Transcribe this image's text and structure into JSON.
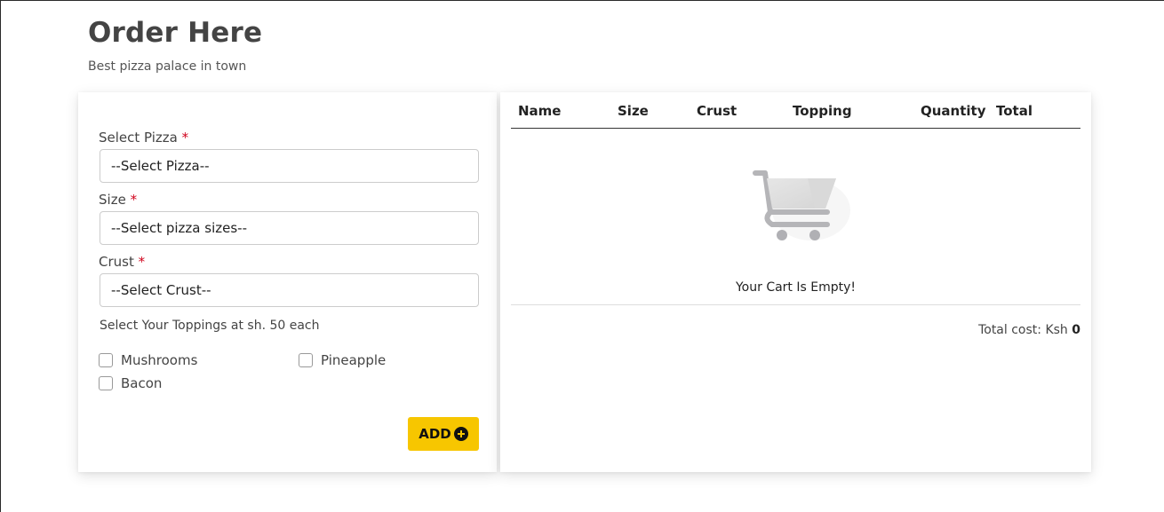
{
  "header": {
    "title": "Order Here",
    "subtitle": "Best pizza palace in town"
  },
  "form": {
    "pizza": {
      "label": "Select Pizza",
      "required": "*",
      "value": "--Select Pizza--"
    },
    "size": {
      "label": "Size",
      "required": "*",
      "value": "--Select pizza sizes--"
    },
    "crust": {
      "label": "Crust",
      "required": "*",
      "value": "--Select Crust--"
    },
    "toppings_label": "Select Your Toppings at sh. 50 each",
    "toppings": [
      "Mushrooms",
      "Pineapple",
      "Bacon"
    ],
    "add_label": "ADD",
    "add_icon": "plus-circle-icon"
  },
  "cart": {
    "columns": [
      "Name",
      "Size",
      "Crust",
      "Topping",
      "Quantity",
      "Total"
    ],
    "empty_icon": "shopping-cart-icon",
    "empty_text": "Your Cart Is Empty!",
    "total_label": "Total cost: Ksh",
    "total_value": "0"
  },
  "colors": {
    "accent": "#f7c600",
    "required": "#d0021b"
  }
}
